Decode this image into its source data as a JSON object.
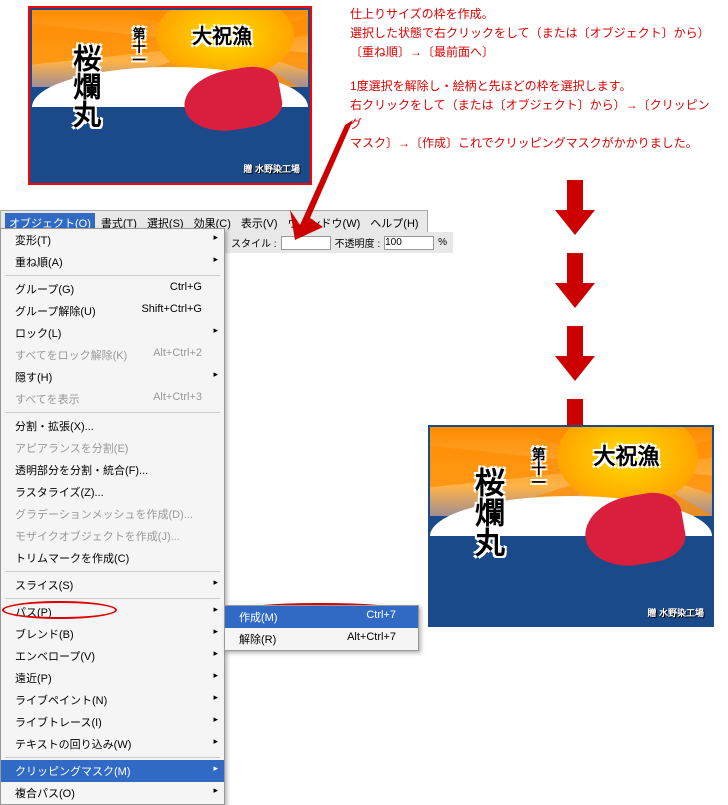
{
  "instructions": {
    "l1": "仕上りサイズの枠を作成。",
    "l2": "選択した状態で右クリックをして（または〔オブジェクト〕から）",
    "l3": "〔重ね順〕→〔最前面へ〕",
    "l4": "1度選択を解除し・絵柄と先ほどの枠を選択します。",
    "l5": "右クリックをして（または〔オブジェクト〕から）→〔クリッピング",
    "l6": "マスク〕→〔作成〕これでクリッピングマスクがかかりました。"
  },
  "menubar": {
    "object": "オブジェクト(O)",
    "format": "書式(T)",
    "select": "選択(S)",
    "effect": "効果(C)",
    "view": "表示(V)",
    "window": "ウィンドウ(W)",
    "help": "ヘルプ(H)"
  },
  "toolbar": {
    "style": "スタイル :",
    "opacity": "不透明度 :",
    "opval": "100",
    "pct": "%"
  },
  "menu": {
    "transform": "変形(T)",
    "arrange": "重ね順(A)",
    "group": "グループ(G)",
    "group_sc": "Ctrl+G",
    "ungroup": "グループ解除(U)",
    "ungroup_sc": "Shift+Ctrl+G",
    "lock": "ロック(L)",
    "unlockall": "すべてをロック解除(K)",
    "unlockall_sc": "Alt+Ctrl+2",
    "hide": "隠す(H)",
    "showall": "すべてを表示",
    "showall_sc": "Alt+Ctrl+3",
    "expand": "分割・拡張(X)...",
    "expandapp": "アピアランスを分割(E)",
    "flatten": "透明部分を分割・統合(F)...",
    "rasterize": "ラスタライズ(Z)...",
    "gradmesh": "グラデーションメッシュを作成(D)...",
    "mosaic": "モザイクオブジェクトを作成(J)...",
    "trim": "トリムマークを作成(C)",
    "slice": "スライス(S)",
    "path": "パス(P)",
    "blend": "ブレンド(B)",
    "envelope": "エンベロープ(V)",
    "perspective": "遠近(P)",
    "livepaint": "ライブペイント(N)",
    "livetrace": "ライブトレース(I)",
    "textwrap": "テキストの回り込み(W)",
    "clipmask": "クリッピングマスク(M)",
    "compound": "複合パス(O)"
  },
  "submenu": {
    "make": "作成(M)",
    "make_sc": "Ctrl+7",
    "release": "解除(R)",
    "release_sc": "Alt+Ctrl+7"
  },
  "flag": {
    "t1": "第十一",
    "t2": "桜爛丸",
    "t3": "大祝漁",
    "credit": "贈 水野染工場"
  }
}
